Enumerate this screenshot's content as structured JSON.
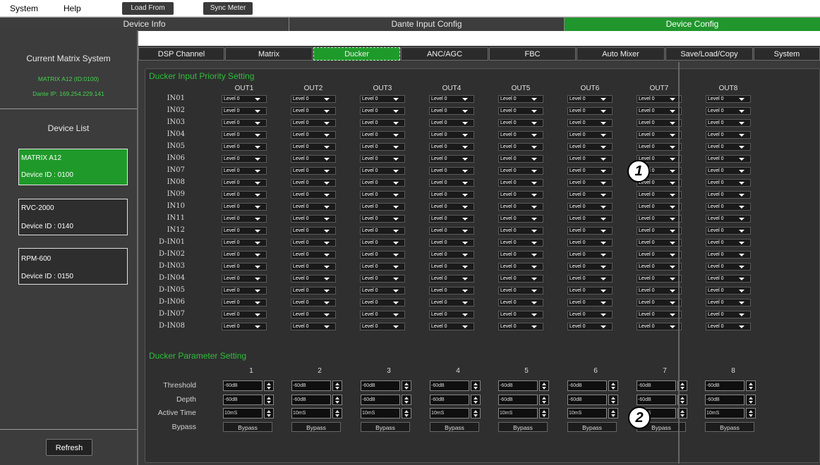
{
  "menubar": {
    "system": "System",
    "help": "Help",
    "load_from_device": "Load From Device",
    "sync_meter": "Sync Meter"
  },
  "top_tabs": [
    {
      "label": "Device Info"
    },
    {
      "label": "Dante Input Config"
    },
    {
      "label": "Device Config"
    }
  ],
  "sidebar": {
    "current_title": "Current Matrix System",
    "matrix_name": "MATRIX A12 (ID:0100)",
    "dante_ip": "Dante IP: 169.254.229.141",
    "device_list_title": "Device List",
    "devices": [
      {
        "name": "MATRIX A12",
        "id": "Device ID : 0100"
      },
      {
        "name": "RVC-2000",
        "id": "Device ID : 0140"
      },
      {
        "name": "RPM-600",
        "id": "Device ID : 0150"
      }
    ],
    "refresh": "Refresh"
  },
  "sub_tabs": [
    {
      "label": "DSP Channel"
    },
    {
      "label": "Matrix"
    },
    {
      "label": "Ducker"
    },
    {
      "label": "ANC/AGC"
    },
    {
      "label": "FBC"
    },
    {
      "label": "Auto Mixer"
    },
    {
      "label": "Save/Load/Copy"
    },
    {
      "label": "System"
    }
  ],
  "priority": {
    "title": "Ducker Input Priority Setting",
    "outputs": [
      "OUT1",
      "OUT2",
      "OUT3",
      "OUT4",
      "OUT5",
      "OUT6",
      "OUT7",
      "OUT8"
    ],
    "inputs": [
      "IN01",
      "IN02",
      "IN03",
      "IN04",
      "IN05",
      "IN06",
      "IN07",
      "IN08",
      "IN09",
      "IN10",
      "IN11",
      "IN12",
      "D-IN01",
      "D-IN02",
      "D-IN03",
      "D-IN04",
      "D-IN05",
      "D-IN06",
      "D-IN07",
      "D-IN08"
    ],
    "level": "Level 0"
  },
  "params": {
    "title": "Ducker Parameter Setting",
    "channels": [
      "1",
      "2",
      "3",
      "4",
      "5",
      "6",
      "7",
      "8"
    ],
    "threshold_label": "Threshold",
    "depth_label": "Depth",
    "active_label": "Active Time",
    "bypass_label": "Bypass",
    "threshold": "-60dB",
    "depth": "-60dB",
    "active_time": "10mS",
    "bypass": "Bypass"
  },
  "callouts": [
    "1",
    "2"
  ],
  "accent": "#20962c"
}
